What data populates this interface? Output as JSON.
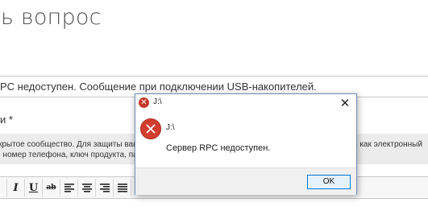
{
  "page": {
    "title": "ть вопрос",
    "subject_value": "PC недоступен. Сообщение при подключении USB-накопителей.",
    "details_label": "ти *",
    "notice_line1_left": "крытое сообщество. Для защиты ваш",
    "notice_line1_right": "е как электронный",
    "notice_line2": ", номер телефона, ключ продукта, пар"
  },
  "toolbar": {
    "italic": "I",
    "underline": "U",
    "strikethrough": "ab"
  },
  "dialog": {
    "title": "J:\\",
    "path_label": "J:\\",
    "message": "Сервер RPC недоступен.",
    "ok_label": "OK",
    "close_glyph": "✕",
    "icon_glyph": "✕"
  },
  "colors": {
    "error_red": "#d33f2f",
    "accent_blue": "#0078d7",
    "notice_bg": "#ececec"
  }
}
